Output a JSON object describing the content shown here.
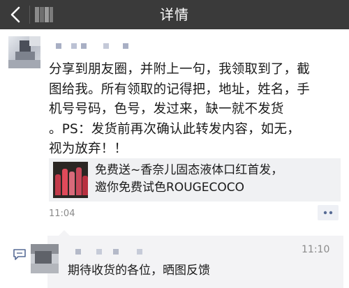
{
  "header": {
    "title": "详情"
  },
  "post": {
    "text": "分享到朋友圈，并附上一句，我领取到了，截\n图给我。所有领取的记得把，地址，姓名，手\n机号号码，色号，发过来，缺一就不发货\n。PS：发货前再次确认此转发内容，如无，\n视为放弃！！",
    "time": "11:04",
    "shared_card": {
      "title": "免费送~香奈儿固态液体口红首发，\n邀你免费试色ROUGECOCO"
    }
  },
  "comment": {
    "time": "11:10",
    "text": "期待收货的各位，晒图反馈"
  },
  "colors": {
    "nav_bg": "#3a3a3a",
    "link_blue": "#576b95",
    "comment_bg": "#f3f3f5"
  },
  "icons": {
    "back": "chevron-left-icon",
    "comment": "comment-icon",
    "more": "more-dots-icon"
  }
}
